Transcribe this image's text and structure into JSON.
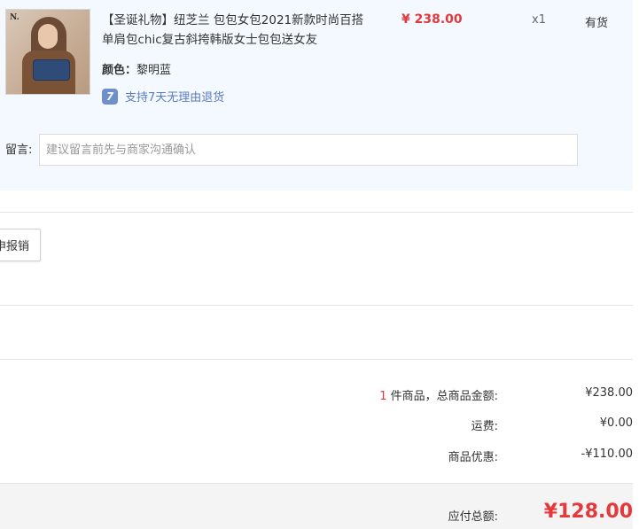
{
  "product": {
    "logo": "N.",
    "title": "【圣诞礼物】纽芝兰 包包女包2021新款时尚百搭单肩包chic复古斜挎韩版女士包包送女友",
    "price": "¥ 238.00",
    "quantity": "x1",
    "stock_status": "有货",
    "color_label": "颜色：",
    "color_value": "黎明蓝",
    "return_icon_text": "7",
    "return_policy": "支持7天无理由退货"
  },
  "remark": {
    "label": "留言:",
    "placeholder": "建议留言前先与商家沟通确认"
  },
  "invoice": {
    "button_label": "申报销"
  },
  "summary": {
    "item_count": "1",
    "goods_label": " 件商品，总商品金额:",
    "goods_total": "¥238.00",
    "shipping_label": "运费:",
    "shipping_value": "¥0.00",
    "discount_label": "商品优惠:",
    "discount_value": "-¥110.00",
    "payable_label": "应付总额:",
    "payable_value": "¥128.00"
  },
  "colors": {
    "price_red": "#e4393c",
    "order_block_bg": "#f3f9fe",
    "return_link_blue": "#5b7cc0"
  }
}
